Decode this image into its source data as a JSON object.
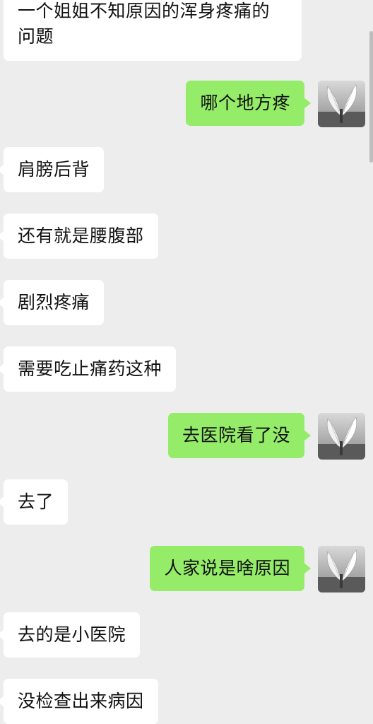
{
  "messages": [
    {
      "side": "in",
      "text": "一个姐姐不知原因的浑身疼痛的问题"
    },
    {
      "side": "out",
      "text": "哪个地方疼"
    },
    {
      "side": "in",
      "text": "肩膀后背"
    },
    {
      "side": "in",
      "text": "还有就是腰腹部"
    },
    {
      "side": "in",
      "text": "剧烈疼痛"
    },
    {
      "side": "in",
      "text": "需要吃止痛药这种"
    },
    {
      "side": "out",
      "text": "去医院看了没"
    },
    {
      "side": "in",
      "text": "去了"
    },
    {
      "side": "out",
      "text": "人家说是啥原因"
    },
    {
      "side": "in",
      "text": "去的是小医院"
    },
    {
      "side": "in",
      "text": "没检查出来病因"
    }
  ],
  "colors": {
    "background": "#ededed",
    "incoming_bubble": "#ffffff",
    "outgoing_bubble": "#95ec69",
    "text": "#111111"
  },
  "avatar_icon": "angel-wings-avatar-icon"
}
